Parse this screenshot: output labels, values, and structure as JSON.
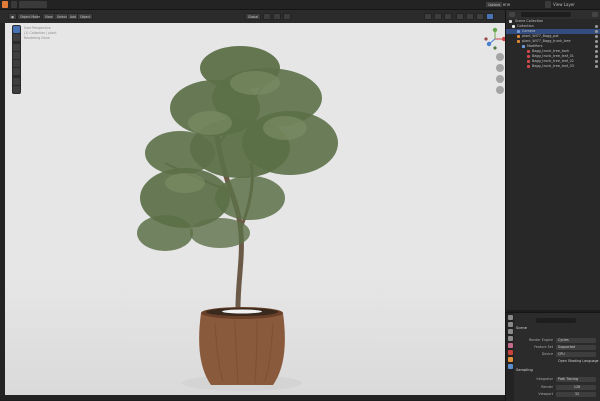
{
  "app": {
    "menu": [
      "File",
      "Edit",
      "Render",
      "Window",
      "Help"
    ],
    "scene_name": "Scene",
    "view_layer": "View Layer"
  },
  "viewport_header": {
    "mode": "Object Mode",
    "menus": [
      "View",
      "Select",
      "Add",
      "Object"
    ],
    "transform": "Global",
    "options": "Options"
  },
  "viewport_info": {
    "line1": "User Perspective",
    "line2": "(1) Collection | plant",
    "line3": "Rendering Done"
  },
  "outliner": {
    "title": "Scene Collection",
    "items": [
      {
        "label": "Collection",
        "level": 0,
        "selected": false,
        "color": "#e8e8e8"
      },
      {
        "label": "Camera",
        "level": 1,
        "selected": true,
        "color": "#7b9bd6"
      },
      {
        "label": "plant_Wl77_Bagg_pot",
        "level": 1,
        "selected": false,
        "color": "#e08a3a"
      },
      {
        "label": "plant_Wl77_Bagg_trunk_tree",
        "level": 1,
        "selected": false,
        "color": "#e08a3a"
      },
      {
        "label": "Modifiers",
        "level": 2,
        "selected": false,
        "color": "#6f9fe0"
      },
      {
        "label": "Bagg_trunk_tree_bark",
        "level": 3,
        "selected": false,
        "color": "#d44a4a"
      },
      {
        "label": "Bagg_trunk_tree_leaf_01",
        "level": 3,
        "selected": false,
        "color": "#d44a4a"
      },
      {
        "label": "Bagg_trunk_tree_leaf_02",
        "level": 3,
        "selected": false,
        "color": "#d44a4a"
      },
      {
        "label": "Bagg_trunk_tree_leaf_03",
        "level": 3,
        "selected": false,
        "color": "#d44a4a"
      }
    ]
  },
  "properties": {
    "context": "Scene",
    "render_engine_label": "Render Engine",
    "render_engine": "Cycles",
    "feature_set_label": "Feature Set",
    "feature_set": "Supported",
    "device_label": "Device",
    "device": "CPU",
    "osl_label": "Open Shading Language",
    "sampling_title": "Sampling",
    "integrator_label": "Integrator",
    "integrator": "Path Tracing",
    "render_label": "Render",
    "render_samples": "128",
    "viewport_label": "Viewport",
    "viewport_samples": "32"
  },
  "colors": {
    "viewport_bg": "#e6e6e7",
    "selection": "#334d80",
    "accent": "#4772b3",
    "leaf": "#5c7048",
    "pot": "#8a5a3c"
  }
}
